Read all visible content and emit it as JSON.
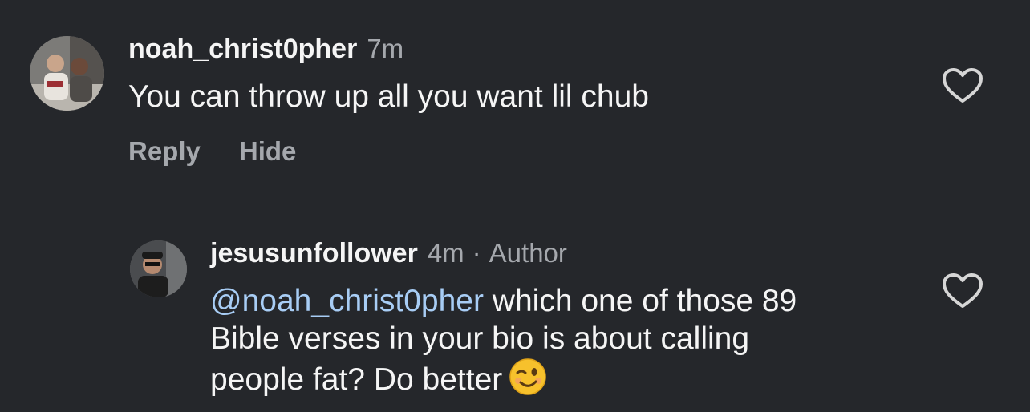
{
  "comments": [
    {
      "username": "noah_christ0pher",
      "time": "7m",
      "text": "You can throw up all you want lil chub",
      "actions": [
        "Reply",
        "Hide"
      ]
    },
    {
      "username": "jesusunfollower",
      "time": "4m",
      "separator": "·",
      "badge": "Author",
      "mention": "@noah_christ0pher",
      "text_line1": " which one of those 89",
      "text_line2": "Bible verses in your bio is about calling",
      "text_line3": "people fat? Do better"
    }
  ],
  "icons": {
    "like": "heart-outline-icon",
    "emoji": "winking-face-emoji"
  },
  "colors": {
    "background": "#25272b",
    "text": "#f5f5f5",
    "muted": "#a5a8ad",
    "mention": "#a8cdf5"
  }
}
